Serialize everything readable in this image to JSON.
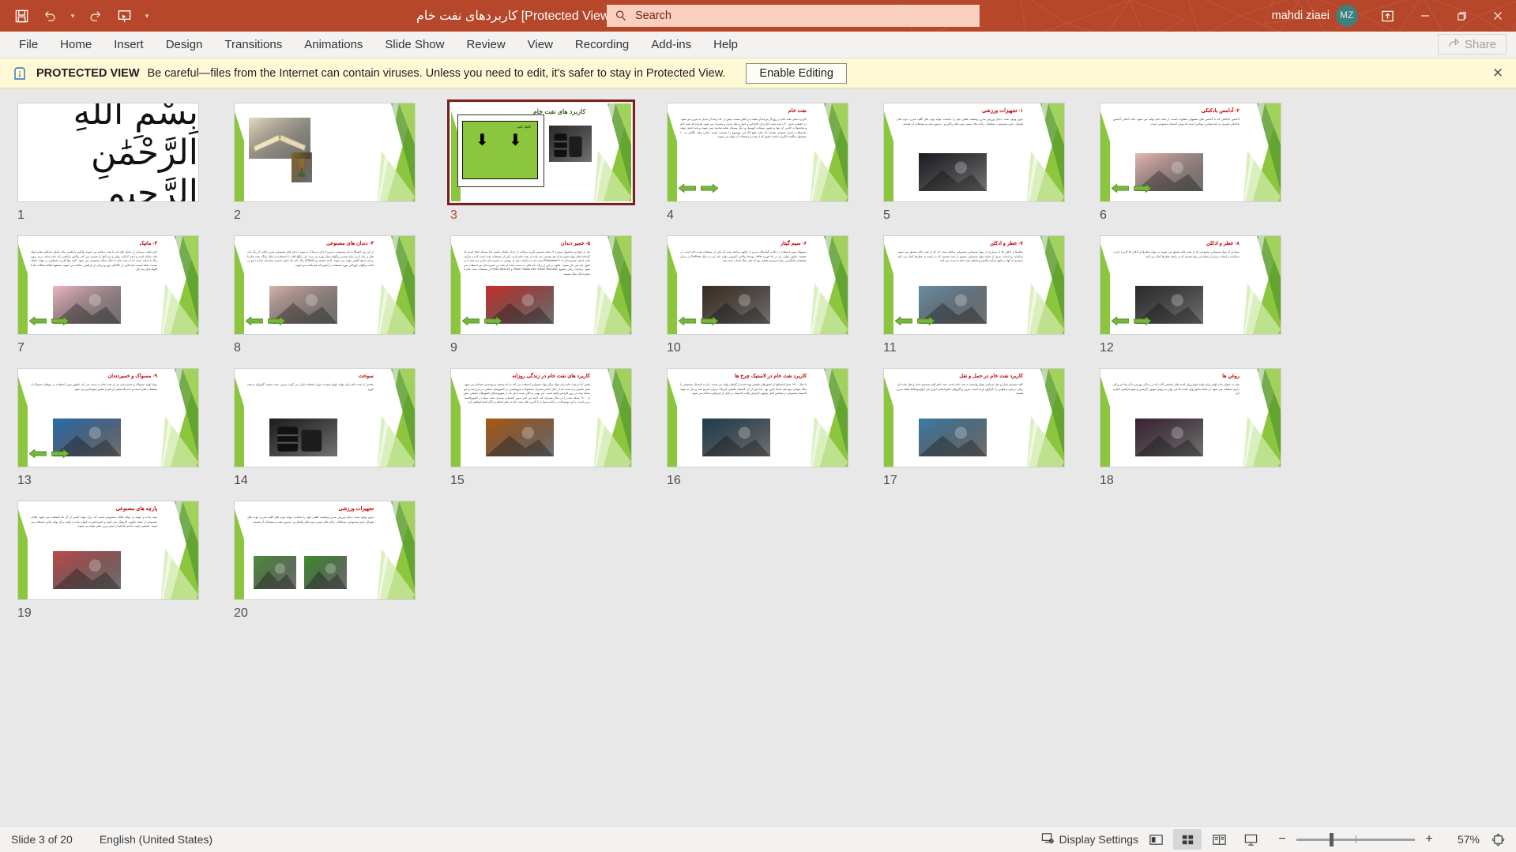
{
  "titlebar": {
    "document_title": "کاربردهای نفت خام [Protected View]  -  PowerPoint",
    "user_name": "mahdi ziaei",
    "avatar_initials": "MZ",
    "accent_color": "#b7472a",
    "quick_access": [
      {
        "name": "save-icon",
        "label": "Save"
      },
      {
        "name": "undo-icon",
        "label": "Undo"
      },
      {
        "name": "redo-icon",
        "label": "Redo"
      },
      {
        "name": "start-presentation-icon",
        "label": "Start From Beginning"
      },
      {
        "name": "customize-qat-icon",
        "label": "Customize Quick Access Toolbar"
      }
    ],
    "window_controls": [
      {
        "name": "ribbon-display-options-icon",
        "label": "Ribbon Display Options"
      },
      {
        "name": "minimize-icon",
        "label": "Minimize"
      },
      {
        "name": "restore-icon",
        "label": "Restore Down"
      },
      {
        "name": "close-icon",
        "label": "Close"
      }
    ]
  },
  "search": {
    "placeholder": "Search",
    "icon": "search-icon"
  },
  "ribbon": {
    "tabs": [
      {
        "label": "File"
      },
      {
        "label": "Home"
      },
      {
        "label": "Insert"
      },
      {
        "label": "Design"
      },
      {
        "label": "Transitions"
      },
      {
        "label": "Animations"
      },
      {
        "label": "Slide Show"
      },
      {
        "label": "Review"
      },
      {
        "label": "View"
      },
      {
        "label": "Recording"
      },
      {
        "label": "Add-ins"
      },
      {
        "label": "Help"
      }
    ],
    "share_label": "Share",
    "share_icon": "share-icon"
  },
  "protected_view": {
    "icon": "info-icon",
    "strong_label": "PROTECTED VIEW",
    "message": "Be careful—files from the Internet can contain viruses. Unless you need to edit, it's safer to stay in Protected View.",
    "enable_button": "Enable Editing",
    "close_icon": "close-icon"
  },
  "sorter": {
    "selected_slide": 3,
    "slides": [
      {
        "number": "1",
        "kind": "bismillah",
        "title": "",
        "body": "",
        "glyph": "بِسْمِ اللَّهِ الرَّحْمَٰنِ الرَّحِيمِ"
      },
      {
        "number": "2",
        "kind": "images-only",
        "title": "",
        "body": "",
        "images": [
          "book-image",
          "trophy-image"
        ]
      },
      {
        "number": "3",
        "kind": "cover",
        "title": "کاربرد های نفت خام",
        "button_label": "کلیک کنید",
        "images": [
          "oil-barrels-image"
        ]
      },
      {
        "number": "4",
        "kind": "text-arrows",
        "title": "نفت خام",
        "body": "کاربرد اصلی نفت خام در روزگار نو چندان تعجب بر انگیز نیست. بیش از ۵۰ درصد آن تبدیل به بنزین می شود. در حقیقت حدود ۷۰ درصد نفت خام برای جابجایی و حمل و نقل تبدیل و مصرف می شود. هرچند که نفت خام و محصولات جانبی آن تنها به همین سوخت اتومبیل و دیگر وسایل نقلیه محدود نمی شوند و پایه اصلی تولید محصولات بسیار متنوعی هستند که شاید هیچ گاه این موضوع را نشنیده باشید. اجازه دهید نگاهی به ۱۰ محصول شگفت انگیزی داشته باشیم که از نفت و مشتقات آن تولید می شوند.",
        "arrows": true
      },
      {
        "number": "5",
        "kind": "text-image",
        "title": "۱- تجهیزات ورزشی",
        "body": "بدون وجود نفت، دنیای ورزش مدرن وضعیت فعلی خود را نداشت. تولید توپ های گلف مدرن، توپ های فوتبال، چمن مصنوعی، بسکتبال، راکت های تنیس، توپ های راکتی و ...مدیون نفت و مشتقات آن هستند.",
        "images": [
          "basketball-image"
        ]
      },
      {
        "number": "6",
        "kind": "text-image-arrows",
        "title": "۲- آدامس بادکنکی",
        "body": "آدامس بادکنکی که با آدامس های معمولی متفاوت است، از نفت خام تولید می شود. ماده اصلی آدامس بادکنکی پلیمری به نام استایرن بوتادین است که نوعی لاستیک مصنوعی است.",
        "images": [
          "bubblegum-image"
        ],
        "arrows": true
      },
      {
        "number": "7",
        "kind": "text-image-arrows",
        "title": "۳- ماتیک",
        "body": "اخم نکنید، بسیاری از ماتیک های لب با نفت ساخته می شوند. واکس پارافینی ماده اصلی تشکیل دهنده لوله های ماتیک است و آنچه کارکرد روان و نرم آنها را تضمین می کند. واکس پارافینی یک ماده جامد، نرم، بدون رنگ یا سفید است که از نفت خام یا ذغال سنگ مصنوعی می شود. البته تنها کاربرد پارافینی در تولید ماتیک نیست، بلکه لیست بلندبالایی از کالاهای دور و برمان از پارافینی ساخته می شوند: شمعها، لفافه شکلات ها یا گلوله های بیت بال.",
        "images": [
          "lipstick-image"
        ],
        "arrows": true
      },
      {
        "number": "8",
        "kind": "text-image-arrows",
        "title": "۴- دندان های مصنوعی",
        "body": "از این بین احتمالا دندان مصنوعی بدترین اندکی ترسناک تر شود. دندان های مصنوعی مدرن اغلب از رنگ دانه های بر پایه کربن برای چسبی رنگهای شان بهره می برند. این رنگها اغلب با استفاده از ذغال سنگ، نفت خام یا برخی منابع گیاهی تولید می شوند. البته هستند و (FD&C) رنگ دانه ها دارای تاییدیه سازمان غذا و دارو در اغلب رنگهای خوراکی مورد استفاده در آشپزخانه هم یافت می شوند.",
        "images": [
          "dentures-image"
        ],
        "arrows": true
      },
      {
        "number": "9",
        "kind": "text-image-arrows",
        "title": "۵- خمیر دندان",
        "body": "بعد از خواندن محصول شماره ۴، شاید تصمیم بگیرید مراقب از دندان هایتان باشید. اما مسئله اینجا است که کارخانه های تولید خمیردندان هم معرفی سه ماده از نفت خام دارند. یکی از مشتقات نفت است که در ترکیب ماده اصلی خمیردندان ۴۰۷ Poloxamer است که به ترکیبات پایه ی روغنی در خمیردندان اجازه می دهد تا در طول پایه این حل شوند. علاوه بر این از رنگ دانه های به دست آمده از نفت در خمیردندان نیز استفاده می شود. ترکیبات رنگی معمول FD&C Yellow #10 ،FD&C Red #30 و FD&C Blue #1 از مشتقات نفت خام با منابع ذغال سنگ هستند.",
        "images": [
          "toothpaste-image"
        ],
        "arrows": true
      },
      {
        "number": "10",
        "kind": "text-image-arrows",
        "title": "۶- سیم گیتار",
        "body": "سیمهای مورد استفاده در اغلب گیتارهای مدرن از نایلون ساخته شده که یکی از مشتقات نفت خام است. در حقیقت نایلون اولین بار در ۲۸ فوریه ۱۹۳۵ توسط والاس کاروترز تولید شد. او به دنبال DuPont در مرکز تحقیقاتی جایگزینی برای ابریشم طبیعی بود که طی جنگ کمیاب شده بود.",
        "images": [
          "guitar-strings-image"
        ],
        "arrows": true
      },
      {
        "number": "11",
        "kind": "text-image-arrows",
        "title": "۷- عطر و ادکلن",
        "body": "عطرها و ادکلن ها از بسیاری از مواد شیمیایی مصنوعی ساخته شده اند که از نفت خام مشتق می شوند. بنزالدئید و استات بنزیل از جمله مواد شیمیایی مشتق از نفت هستند که به رایحه ی عطرها کمک می کنند. بسیاری از آنها در طول فرآیند پالایش و تقطیر نفت خام به دست می آیند.",
        "images": [
          "perfume-image"
        ],
        "arrows": true
      },
      {
        "number": "12",
        "kind": "text-image-arrows",
        "title": "۸- عطر و ادکلن",
        "body": "بسیاری از مواد شیمیایی مصنوعی که از نفت خام مشتق می شوند در تولید عطرها و ادکلن ها کاربرد دارند. بنزالدئید و استات بنزیل از جمله این مواد هستند که به رایحه عطرها کمک می کنند.",
        "images": [
          "perfume-bottles-image"
        ],
        "arrows": true
      },
      {
        "number": "13",
        "kind": "text-image-arrows",
        "title": "۹- مسواک و خمیردندان",
        "body": "مواد اولیه مسواک و خمیردندان نیز از نفت خام به دست می آید. نایلون مورد استفاده در موهای مسواک از مشتقات نفتی است و بدنه پلاستیکی آن هم از همین منبع تامین می شود.",
        "images": [
          "toothbrush-products-image"
        ],
        "arrows": true
      },
      {
        "number": "14",
        "kind": "text-image",
        "title": "سوخت",
        "body": "بخشی از نفت خام برای تولید انواع سوخت مورد استفاده قرار می گیرد: بنزین، نفت سفید، گازوئیل و نفت کوره.",
        "images": [
          "oil-barrels-black-image"
        ]
      },
      {
        "number": "15",
        "kind": "text-image",
        "title": "کاربرد های نفت خام در زندگی روزانه",
        "body": "همین که از نفت خام برای تولید دیگر مواد شیمیایی استفاده می کند به نام صنعت پتروشیمی شناخته می شود. یعنی تخمین زده شده که از حال حاضر مصرف محصولات پتروشیمی در کشورهای صنعتی در نرخ سه و نیم بشکه نفت در روز افزایش یافته است. این بهتر، زندگان شده با هر یک از شهروندهای کشورهای صنعتی بیش از ۱۲۰۰ بشکه نفت را در سال مصرف کند. البته این آمار بدون احتساب مصرف نفت سیاه در کشورهاست درین است. با این توضیحات در ادامه شما را با کاربرد های نفت خام در نظر لحظه زندگان آشنا خواهیم کرد.",
        "images": [
          "refinery-image"
        ]
      },
      {
        "number": "16",
        "kind": "text-image",
        "title": "کاربرد نفت خام در لاستیک چرخ ها",
        "body": "تا سال ۱۹۱۰ تمام لاستیکها از کشورهای طبیعی تهیه شده از گیاهان تولید می شدند. نیاز به لاستیک مصنوعی با جنگ جهانی دوم هم نسبتاً پایین بود. اما پس از آن لاستیک طبیعی آمریکا، میزان تحریم شد و نیاز به تولید لاستیک مصنوعی در مقیاس قابل توجهی افزایش یافت. لاستیک در اصل از چیزهایی ساخته می شود.",
        "images": [
          "tire-oil-image"
        ]
      },
      {
        "number": "17",
        "kind": "text-image",
        "title": "کاربرد نفت خام در حمل و نقل",
        "body": "کلیه سیستم حمل و نقل سراسر جهان وابسته به نفت خام است. نفت خام کلیه سیستم حمل و نقل جاده ای، ریلی، دریایی و هوایی را دگرگون کرده است. بنزین و گازوئیل منابع اصلی انرژی نیاز انواع وسائط نقلیه مدرن هستند.",
        "images": [
          "cargo-ship-image"
        ]
      },
      {
        "number": "18",
        "kind": "text-image",
        "title": "روغن ها",
        "body": "نفت به عنوان ماده اولیه برای تولید انواع روان کننده های ماشینی آلات که در زندگی روزمره با آن ها سر و کار داریم استفاده می شود. از جمله منابع روان کننده ها می توان به روغن موتور، گریسی و موم پارافینی اشاره کرد.",
        "images": [
          "oil-pumpjacks-image"
        ]
      },
      {
        "number": "19",
        "kind": "text-image",
        "title": "پارچه های مصنوعی",
        "body": "نفت ماده ی اولیه ی تولید الیاف مصنوعی است که برای تولید لباس از آن ها استفاده می شود. الیاف مصنوعی از جمله نایلون، اکریلیک، پلی استر و اسپندکس به عنوان ماده ی اولیه برای تولید لباس استفاده می شوند. همچنین چوب لباسی ها هم از جنس رزین نفتی تولید می شوند.",
        "images": [
          "thread-spools-image"
        ]
      },
      {
        "number": "20",
        "kind": "text-image",
        "title": "تجهیزات ورزشی",
        "body": "بدون وجود نفت، دنیای ورزش مدرن وضعیت فعلی خود را نداشت. تولید توپ های گلف مدرن، توپ های فوتبال، چمن مصنوعی، بسکتبال، راکت های تنیس، توپ های والیبال و... مدیون نفت و مشتقات آن هستند.",
        "images": [
          "golf-ball-image",
          "artificial-turf-image"
        ]
      }
    ]
  },
  "statusbar": {
    "slide_indicator": "Slide 3 of 20",
    "language": "English (United States)",
    "display_settings": "Display Settings",
    "display_settings_icon": "display-settings-icon",
    "views": [
      {
        "name": "normal-view-button",
        "label": "Normal",
        "active": false
      },
      {
        "name": "slide-sorter-button",
        "label": "Slide Sorter",
        "active": true
      },
      {
        "name": "reading-view-button",
        "label": "Reading View",
        "active": false
      },
      {
        "name": "slide-show-button",
        "label": "Slide Show",
        "active": false
      }
    ],
    "zoom_out": "−",
    "zoom_in": "+",
    "zoom_level": "57%",
    "fit_icon": "fit-to-window-icon"
  }
}
